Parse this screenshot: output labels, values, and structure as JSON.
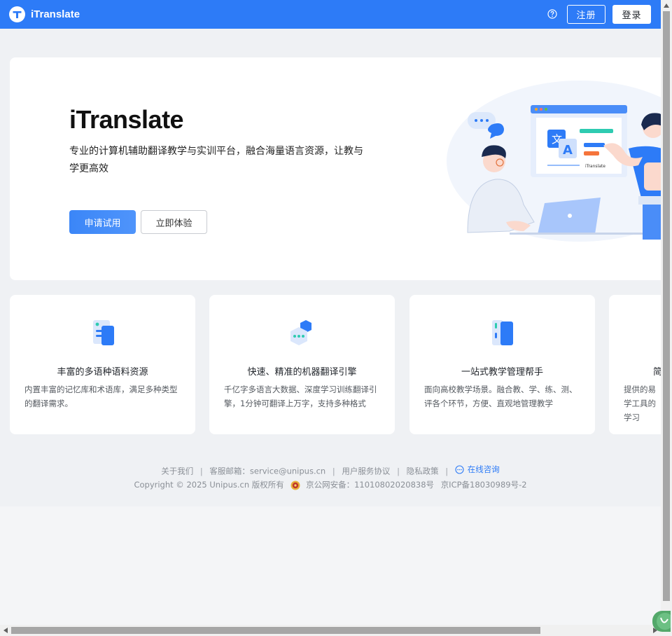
{
  "header": {
    "brand": "iTranslate",
    "register_label": "注册",
    "login_label": "登录"
  },
  "hero": {
    "title": "iTranslate",
    "description": "专业的计算机辅助翻译教学与实训平台，融合海量语言资源，让教与学更高效",
    "apply_label": "申请试用",
    "try_label": "立即体验",
    "illustration_caption": "iTranslate",
    "illustration_letter_a": "A",
    "illustration_letter_wen": "文"
  },
  "features": [
    {
      "title": "丰富的多语种语料资源",
      "desc": "内置丰富的记忆库和术语库，满足多种类型的翻译需求。"
    },
    {
      "title": "快速、精准的机器翻译引擎",
      "desc": "千亿字多语言大数据、深度学习训练翻译引擎，1分钟可翻译上万字，支持多种格式"
    },
    {
      "title": "一站式教学管理帮手",
      "desc": "面向高校教学场景。融合教、学、练、测、评各个环节，方便、直观地管理教学"
    },
    {
      "title": "简",
      "desc": "提供的易学工具的学习"
    }
  ],
  "footer": {
    "about": "关于我们",
    "email": "客服邮箱：service@unipus.cn",
    "terms": "用户服务协议",
    "privacy": "隐私政策",
    "consult": "在线咨询",
    "copyright": "Copyright © 2025 Unipus.cn 版权所有",
    "police": "京公网安备：11010802020838号",
    "icp": "京ICP备18030989号-2"
  },
  "colors": {
    "brand": "#2d7bf7",
    "background": "#eff1f4"
  }
}
